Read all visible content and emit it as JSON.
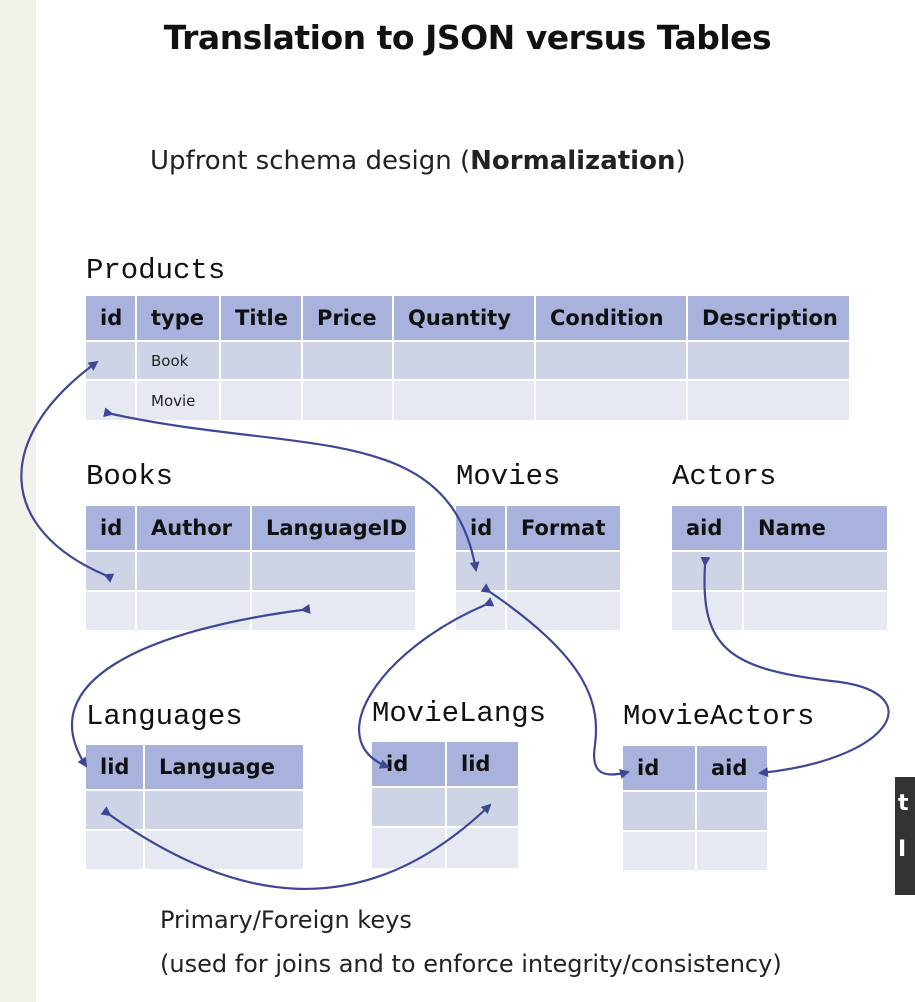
{
  "title": "Translation to JSON versus Tables",
  "subtitle": {
    "prefix": "Upfront schema design (",
    "bold": "Normalization",
    "suffix": ")"
  },
  "tables": {
    "products": {
      "name": "Products",
      "columns": [
        "id",
        "type",
        "Title",
        "Price",
        "Quantity",
        "Condition",
        "Description"
      ],
      "rows": [
        [
          "",
          "Book",
          "",
          "",
          "",
          "",
          ""
        ],
        [
          "",
          "Movie",
          "",
          "",
          "",
          "",
          ""
        ]
      ]
    },
    "books": {
      "name": "Books",
      "columns": [
        "id",
        "Author",
        "LanguageID"
      ]
    },
    "movies": {
      "name": "Movies",
      "columns": [
        "id",
        "Format"
      ]
    },
    "actors": {
      "name": "Actors",
      "columns": [
        "aid",
        "Name"
      ]
    },
    "languages": {
      "name": "Languages",
      "columns": [
        "lid",
        "Language"
      ]
    },
    "movielangs": {
      "name": "MovieLangs",
      "columns": [
        "id",
        "lid"
      ]
    },
    "movieactors": {
      "name": "MovieActors",
      "columns": [
        "id",
        "aid"
      ]
    }
  },
  "footer": {
    "line1": "Primary/Foreign keys",
    "line2": "(used for joins and to enforce integrity/consistency)"
  },
  "overlay": {
    "line1": "t",
    "line2": "I"
  },
  "colors": {
    "header": "#a9b2dc",
    "row_dark": "#cfd3e6",
    "row_light": "#e6e8f2",
    "arrow": "#3e4795"
  }
}
